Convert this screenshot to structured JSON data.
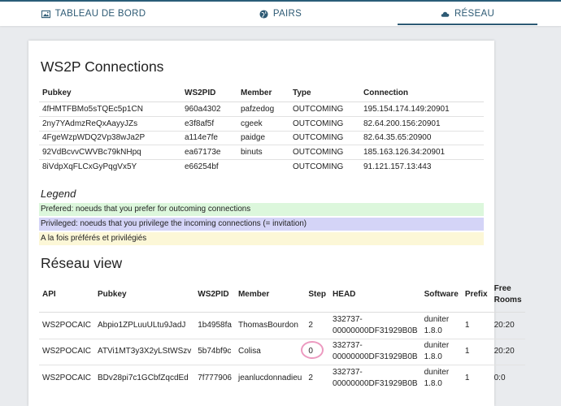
{
  "tabs": [
    {
      "label": "TABLEAU DE BORD",
      "icon": "image-icon"
    },
    {
      "label": "PAIRS",
      "icon": "globe-icon"
    },
    {
      "label": "RÉSEAU",
      "icon": "cloud-icon",
      "active": true
    }
  ],
  "connections": {
    "title": "WS2P Connections",
    "headers": [
      "Pubkey",
      "WS2PID",
      "Member",
      "Type",
      "Connection"
    ],
    "rows": [
      [
        "4fHMTFBMo5sTQEc5p1CN",
        "960a4302",
        "pafzedog",
        "OUTCOMING",
        "195.154.174.149:20901"
      ],
      [
        "2ny7YAdmzReQxAayyJZs",
        "e3f8af5f",
        "cgeek",
        "OUTCOMING",
        "82.64.200.156:20901"
      ],
      [
        "4FgeWzpWDQ2Vp38wJa2P",
        "a114e7fe",
        "paidge",
        "OUTCOMING",
        "82.64.35.65:20900"
      ],
      [
        "92VdBcvvCWVBc79kNHpq",
        "ea67173e",
        "binuts",
        "OUTCOMING",
        "185.163.126.34:20901"
      ],
      [
        "8iVdpXqFLCxGyPqgVx5Y",
        "e66254bf",
        "",
        "OUTCOMING",
        "91.121.157.13:443"
      ]
    ]
  },
  "legend": {
    "title": "Legend",
    "items": [
      "Prefered: noeuds that you prefer for outcoming connections",
      "Privileged: noeuds that you privilege the incoming connections (= invitation)",
      "A la fois préférés et privilégiés"
    ],
    "colors": [
      "#dcf7dc",
      "#d4d4f7",
      "#fcf7d7"
    ]
  },
  "view": {
    "title": "Réseau view",
    "headers": [
      "API",
      "Pubkey",
      "WS2PID",
      "Member",
      "Step",
      "HEAD",
      "Software",
      "Prefix",
      "Free Rooms"
    ],
    "rows": [
      [
        "WS2POCAIC",
        "Abpio1ZPLuuULtu9JadJ",
        "1b4958fa",
        "ThomasBourdon",
        "2",
        "332737-00000000DF31929B0B",
        "duniter 1.8.0",
        "1",
        "20:20"
      ],
      [
        "WS2POCAIC",
        "ATVi1MT3y3X2yLStWSzv",
        "5b74bf9c",
        "Colisa",
        "0",
        "332737-00000000DF31929B0B",
        "duniter 1.8.0",
        "1",
        "20:20"
      ],
      [
        "WS2POCAIC",
        "BDv28pi7c1GCbfZqcdEd",
        "7f777906",
        "jeanlucdonnadieu",
        "2",
        "332737-00000000DF31929B0B",
        "duniter 1.8.0",
        "1",
        "0:0"
      ]
    ]
  },
  "accent": "#2d5a74"
}
